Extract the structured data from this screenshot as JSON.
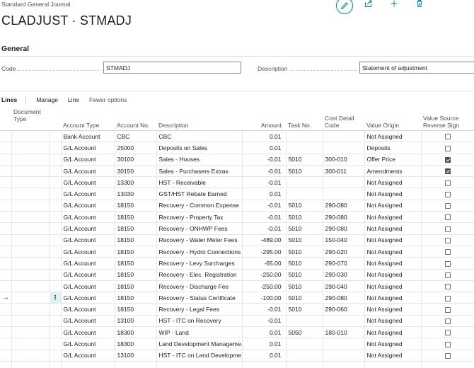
{
  "page": {
    "type_label": "Standard General Journal",
    "title": "CLADJUST · STMADJ"
  },
  "header_actions": [
    {
      "icon": "edit-icon"
    },
    {
      "icon": "share-icon"
    },
    {
      "icon": "add-icon"
    },
    {
      "icon": "delete-icon"
    }
  ],
  "general": {
    "section_title": "General",
    "code_label": "Code",
    "code_value": "STMADJ",
    "description_label": "Description",
    "description_value": "Statement of adjustment"
  },
  "lines": {
    "title": "Lines",
    "actions": [
      "Manage",
      "Line",
      "Fewer options"
    ],
    "columns": {
      "document_type": "Document Type",
      "account_type": "Account Type",
      "account_no": "Account No.",
      "description": "Description",
      "amount": "Amount",
      "task_no": "Task No.",
      "cost_detail_code": "Cost Detail Code",
      "value_origin": "Value Origin",
      "value_source_reverse_sign": "Value Source Reverse Sign"
    },
    "rows": [
      {
        "account_type": "Bank Account",
        "account_no": "CBC",
        "description": "CBC",
        "amount": "0.01",
        "task_no": "",
        "cost_detail_code": "",
        "value_origin": "Not Assigned",
        "reverse_sign": false
      },
      {
        "account_type": "G/L Account",
        "account_no": "25000",
        "description": "Deposits on Sales",
        "amount": "0.01",
        "task_no": "",
        "cost_detail_code": "",
        "value_origin": "Deposits",
        "reverse_sign": false
      },
      {
        "account_type": "G/L Account",
        "account_no": "30100",
        "description": "Sales - Houses",
        "amount": "-0.01",
        "task_no": "5010",
        "cost_detail_code": "300-010",
        "value_origin": "Offer Price",
        "reverse_sign": true
      },
      {
        "account_type": "G/L Account",
        "account_no": "30150",
        "description": "Sales - Purchasers Extras",
        "amount": "-0.01",
        "task_no": "5010",
        "cost_detail_code": "300-011",
        "value_origin": "Amendments",
        "reverse_sign": true
      },
      {
        "account_type": "G/L Account",
        "account_no": "13300",
        "description": "HST - Receivable",
        "amount": "-0.01",
        "task_no": "",
        "cost_detail_code": "",
        "value_origin": "Not Assigned",
        "reverse_sign": false
      },
      {
        "account_type": "G/L Account",
        "account_no": "13030",
        "description": "GST/HST Rebate Earned",
        "amount": "0.01",
        "task_no": "",
        "cost_detail_code": "",
        "value_origin": "Not Assigned",
        "reverse_sign": false
      },
      {
        "account_type": "G/L Account",
        "account_no": "18150",
        "description": "Recovery - Common Expense",
        "amount": "-0.01",
        "task_no": "5010",
        "cost_detail_code": "290-080",
        "value_origin": "Not Assigned",
        "reverse_sign": false
      },
      {
        "account_type": "G/L Account",
        "account_no": "18150",
        "description": "Recovery - Property Tax",
        "amount": "-0.01",
        "task_no": "5010",
        "cost_detail_code": "290-080",
        "value_origin": "Not Assigned",
        "reverse_sign": false
      },
      {
        "account_type": "G/L Account",
        "account_no": "18150",
        "description": "Recovery - ONHWP Fees",
        "amount": "-0.01",
        "task_no": "5010",
        "cost_detail_code": "290-080",
        "value_origin": "Not Assigned",
        "reverse_sign": false
      },
      {
        "account_type": "G/L Account",
        "account_no": "18150",
        "description": "Recovery - Water Meter Fees",
        "amount": "-489.00",
        "task_no": "5010",
        "cost_detail_code": "150-040",
        "value_origin": "Not Assigned",
        "reverse_sign": false
      },
      {
        "account_type": "G/L Account",
        "account_no": "18150",
        "description": "Recovery - Hydro Connections",
        "amount": "-295.00",
        "task_no": "5010",
        "cost_detail_code": "290-020",
        "value_origin": "Not Assigned",
        "reverse_sign": false
      },
      {
        "account_type": "G/L Account",
        "account_no": "18150",
        "description": "Recovery - Levy Surcharges",
        "amount": "-65.00",
        "task_no": "5010",
        "cost_detail_code": "290-070",
        "value_origin": "Not Assigned",
        "reverse_sign": false
      },
      {
        "account_type": "G/L Account",
        "account_no": "18150",
        "description": "Recovery - Elec. Registration",
        "amount": "-250.00",
        "task_no": "5010",
        "cost_detail_code": "290-030",
        "value_origin": "Not Assigned",
        "reverse_sign": false
      },
      {
        "account_type": "G/L Account",
        "account_no": "18150",
        "description": "Recovery - Discharge Fee",
        "amount": "-250.00",
        "task_no": "5010",
        "cost_detail_code": "290-040",
        "value_origin": "Not Assigned",
        "reverse_sign": false
      },
      {
        "account_type": "G/L Account",
        "account_no": "18150",
        "description": "Recovery - Status Certificate",
        "amount": "-100.00",
        "task_no": "5010",
        "cost_detail_code": "290-080",
        "value_origin": "Not Assigned",
        "reverse_sign": false,
        "current": true
      },
      {
        "account_type": "G/L Account",
        "account_no": "18150",
        "description": "Recovery - Legal Fees",
        "amount": "-0.01",
        "task_no": "5010",
        "cost_detail_code": "290-060",
        "value_origin": "Not Assigned",
        "reverse_sign": false
      },
      {
        "account_type": "G/L Account",
        "account_no": "13100",
        "description": "HST - ITC on Recovery",
        "amount": "-0.01",
        "task_no": "",
        "cost_detail_code": "",
        "value_origin": "Not Assigned",
        "reverse_sign": false
      },
      {
        "account_type": "G/L Account",
        "account_no": "18300",
        "description": "WIP - Land",
        "amount": "0.01",
        "task_no": "5050",
        "cost_detail_code": "180-010",
        "value_origin": "Not Assigned",
        "reverse_sign": false
      },
      {
        "account_type": "G/L Account",
        "account_no": "18300",
        "description": "Land Development Manageme...",
        "amount": "0.01",
        "task_no": "",
        "cost_detail_code": "",
        "value_origin": "Not Assigned",
        "reverse_sign": false
      },
      {
        "account_type": "G/L Account",
        "account_no": "13100",
        "description": "HST - ITC on Land Developme...",
        "amount": "0.01",
        "task_no": "",
        "cost_detail_code": "",
        "value_origin": "Not Assigned",
        "reverse_sign": false
      },
      {
        "account_type": "",
        "account_no": "",
        "description": "",
        "amount": "",
        "task_no": "",
        "cost_detail_code": "",
        "value_origin": "",
        "reverse_sign": null
      }
    ]
  },
  "colors": {
    "accent": "#00838f",
    "text": "#212121",
    "muted": "#505050",
    "border": "#8a8a8a"
  }
}
